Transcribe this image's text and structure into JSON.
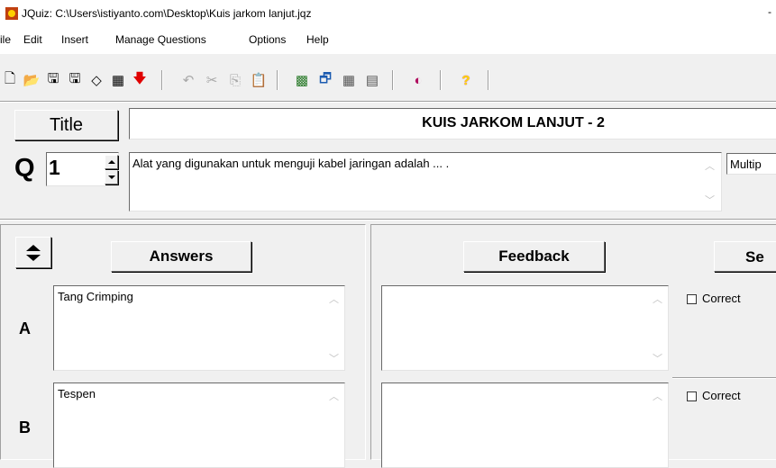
{
  "window": {
    "title": "JQuiz: C:\\Users\\istiyanto.com\\Desktop\\Kuis jarkom lanjut.jqz",
    "title_edge": "-"
  },
  "menu": [
    "ile",
    "Edit",
    "Insert",
    "Manage Questions",
    "Options",
    "Help"
  ],
  "toolbar": {
    "icons": [
      "new-file-icon",
      "open-folder-icon",
      "save-icon",
      "save-as-icon",
      "eraser-icon",
      "web-export-icon",
      "down-arrow-icon",
      "undo-icon",
      "cut-icon",
      "copy-icon",
      "paste-icon",
      "export-web-icon",
      "config-icon",
      "add-record-icon",
      "delete-record-icon",
      "colors-icon",
      "help-icon"
    ],
    "glyphs": [
      "🗋",
      "📂",
      "🖫",
      "🖫",
      "◇",
      "▦",
      "🡇",
      "↶",
      "✂",
      "⎘",
      "📋",
      "▩",
      "🗗",
      "▦",
      "▤",
      "◐",
      "?"
    ]
  },
  "quiz": {
    "title_label": "Title",
    "title_value": "KUIS JARKOM LANJUT - 2",
    "question_label": "Q",
    "question_number": "1",
    "question_text": "Alat yang digunakan untuk menguji kabel jaringan adalah ... .",
    "question_type": "Multip"
  },
  "columns": {
    "answers": "Answers",
    "feedback": "Feedback",
    "settings": "Se"
  },
  "answers": [
    {
      "letter": "A",
      "text": "Tang Crimping",
      "feedback": "",
      "correct_label": "Correct",
      "correct": false
    },
    {
      "letter": "B",
      "text": "Tespen",
      "feedback": "",
      "correct_label": "Correct",
      "correct": false
    }
  ],
  "colors": {
    "background": "#f0f0f0",
    "help_icon": "#ffd800",
    "down_arrow": "#e00000"
  }
}
